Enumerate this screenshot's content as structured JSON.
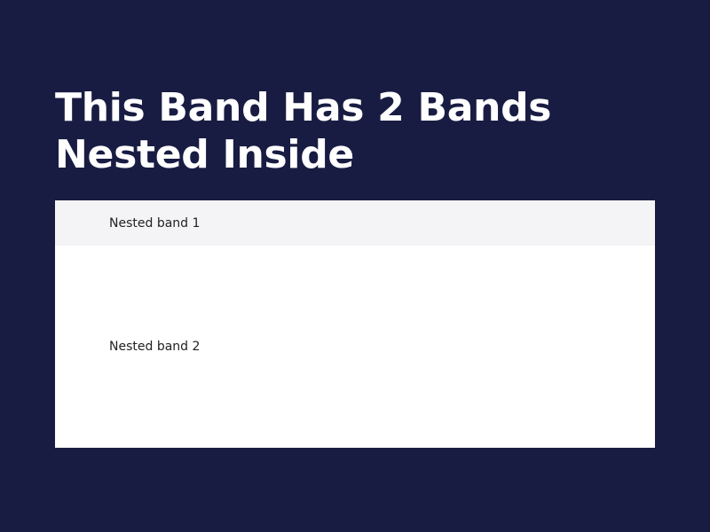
{
  "page": {
    "background_color": "#191c42"
  },
  "heading": {
    "line1": "This Band Has 2 Bands",
    "line2": "Nested Inside"
  },
  "nested_bands": [
    {
      "label": "Nested band 1",
      "background_color": "#f4f4f6"
    },
    {
      "label": "Nested band 2",
      "background_color": "#ffffff"
    }
  ]
}
